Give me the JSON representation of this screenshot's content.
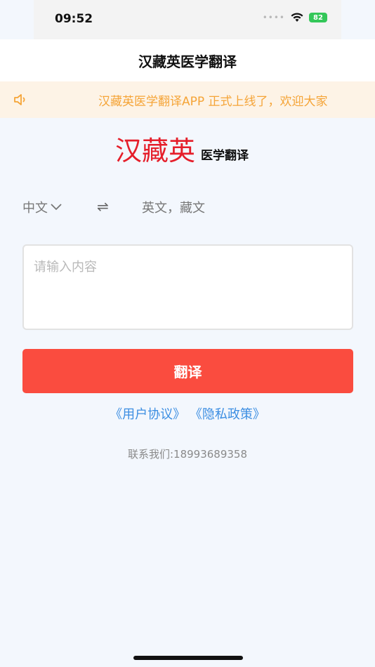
{
  "status_bar": {
    "time": "09:52",
    "battery": "82",
    "signal_icon": "signal-icon",
    "wifi_icon": "wifi-icon"
  },
  "nav": {
    "title": "汉藏英医学翻译"
  },
  "notice": {
    "icon": "speaker-icon",
    "text": "汉藏英医学翻译APP 正式上线了，欢迎大家"
  },
  "logo": {
    "main": "汉藏英",
    "sub": "医学翻译"
  },
  "language": {
    "source": "中文",
    "swap_symbol": "⇌",
    "target": "英文，藏文"
  },
  "input": {
    "placeholder": "请输入内容",
    "value": ""
  },
  "translate_button": {
    "label": "翻译"
  },
  "links": {
    "user_agreement": "《用户协议》",
    "privacy_policy": "《隐私政策》"
  },
  "contact": {
    "text": "联系我们:18993689358"
  },
  "colors": {
    "accent_red": "#fa4c3f",
    "logo_red": "#e51e2a",
    "notice_orange": "#f5a437",
    "link_blue": "#3c8ee2",
    "battery_green": "#34c759"
  }
}
